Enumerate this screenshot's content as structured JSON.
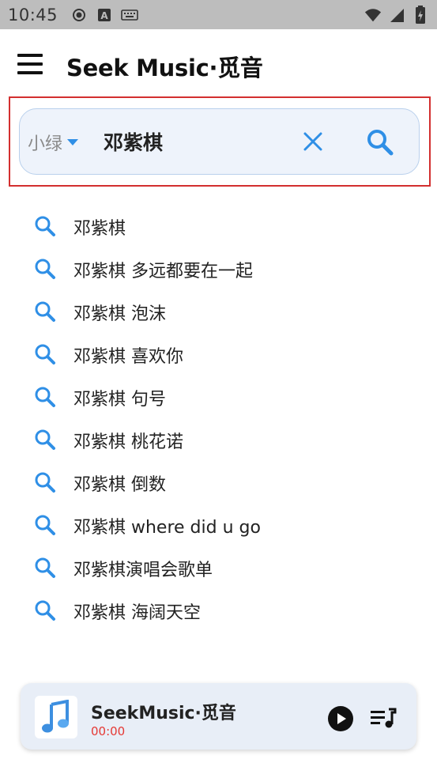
{
  "status_bar": {
    "time": "10:45",
    "icons": [
      "record-icon",
      "a-icon",
      "keyboard-icon",
      "wifi-icon",
      "signal-icon",
      "battery-charging-icon"
    ]
  },
  "app_bar": {
    "title": "Seek Music·觅音",
    "menu_icon": "hamburger-menu-icon"
  },
  "search": {
    "source_label": "小绿",
    "query": "邓紫棋",
    "placeholder": "",
    "accent_color": "#2f8fe6",
    "highlight_color": "#d32f2f"
  },
  "suggestions": [
    "邓紫棋",
    "邓紫棋 多远都要在一起",
    "邓紫棋 泡沫",
    "邓紫棋 喜欢你",
    "邓紫棋 句号",
    "邓紫棋 桃花诺",
    "邓紫棋 倒数",
    "邓紫棋 where did u go",
    "邓紫棋演唱会歌单",
    "邓紫棋 海阔天空"
  ],
  "player": {
    "title": "SeekMusic·觅音",
    "time": "00:00",
    "time_color": "#e53935",
    "cover_icon": "music-note-icon",
    "play_icon": "play-icon",
    "queue_icon": "playlist-icon"
  }
}
